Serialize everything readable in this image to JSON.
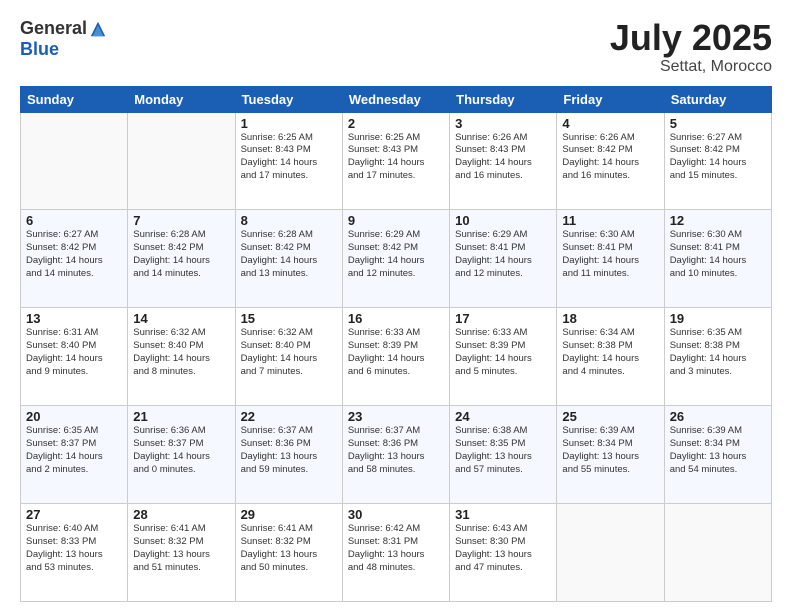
{
  "header": {
    "logo_general": "General",
    "logo_blue": "Blue",
    "month_title": "July 2025",
    "location": "Settat, Morocco"
  },
  "weekdays": [
    "Sunday",
    "Monday",
    "Tuesday",
    "Wednesday",
    "Thursday",
    "Friday",
    "Saturday"
  ],
  "weeks": [
    [
      {
        "day": "",
        "info": ""
      },
      {
        "day": "",
        "info": ""
      },
      {
        "day": "1",
        "info": "Sunrise: 6:25 AM\nSunset: 8:43 PM\nDaylight: 14 hours\nand 17 minutes."
      },
      {
        "day": "2",
        "info": "Sunrise: 6:25 AM\nSunset: 8:43 PM\nDaylight: 14 hours\nand 17 minutes."
      },
      {
        "day": "3",
        "info": "Sunrise: 6:26 AM\nSunset: 8:43 PM\nDaylight: 14 hours\nand 16 minutes."
      },
      {
        "day": "4",
        "info": "Sunrise: 6:26 AM\nSunset: 8:42 PM\nDaylight: 14 hours\nand 16 minutes."
      },
      {
        "day": "5",
        "info": "Sunrise: 6:27 AM\nSunset: 8:42 PM\nDaylight: 14 hours\nand 15 minutes."
      }
    ],
    [
      {
        "day": "6",
        "info": "Sunrise: 6:27 AM\nSunset: 8:42 PM\nDaylight: 14 hours\nand 14 minutes."
      },
      {
        "day": "7",
        "info": "Sunrise: 6:28 AM\nSunset: 8:42 PM\nDaylight: 14 hours\nand 14 minutes."
      },
      {
        "day": "8",
        "info": "Sunrise: 6:28 AM\nSunset: 8:42 PM\nDaylight: 14 hours\nand 13 minutes."
      },
      {
        "day": "9",
        "info": "Sunrise: 6:29 AM\nSunset: 8:42 PM\nDaylight: 14 hours\nand 12 minutes."
      },
      {
        "day": "10",
        "info": "Sunrise: 6:29 AM\nSunset: 8:41 PM\nDaylight: 14 hours\nand 12 minutes."
      },
      {
        "day": "11",
        "info": "Sunrise: 6:30 AM\nSunset: 8:41 PM\nDaylight: 14 hours\nand 11 minutes."
      },
      {
        "day": "12",
        "info": "Sunrise: 6:30 AM\nSunset: 8:41 PM\nDaylight: 14 hours\nand 10 minutes."
      }
    ],
    [
      {
        "day": "13",
        "info": "Sunrise: 6:31 AM\nSunset: 8:40 PM\nDaylight: 14 hours\nand 9 minutes."
      },
      {
        "day": "14",
        "info": "Sunrise: 6:32 AM\nSunset: 8:40 PM\nDaylight: 14 hours\nand 8 minutes."
      },
      {
        "day": "15",
        "info": "Sunrise: 6:32 AM\nSunset: 8:40 PM\nDaylight: 14 hours\nand 7 minutes."
      },
      {
        "day": "16",
        "info": "Sunrise: 6:33 AM\nSunset: 8:39 PM\nDaylight: 14 hours\nand 6 minutes."
      },
      {
        "day": "17",
        "info": "Sunrise: 6:33 AM\nSunset: 8:39 PM\nDaylight: 14 hours\nand 5 minutes."
      },
      {
        "day": "18",
        "info": "Sunrise: 6:34 AM\nSunset: 8:38 PM\nDaylight: 14 hours\nand 4 minutes."
      },
      {
        "day": "19",
        "info": "Sunrise: 6:35 AM\nSunset: 8:38 PM\nDaylight: 14 hours\nand 3 minutes."
      }
    ],
    [
      {
        "day": "20",
        "info": "Sunrise: 6:35 AM\nSunset: 8:37 PM\nDaylight: 14 hours\nand 2 minutes."
      },
      {
        "day": "21",
        "info": "Sunrise: 6:36 AM\nSunset: 8:37 PM\nDaylight: 14 hours\nand 0 minutes."
      },
      {
        "day": "22",
        "info": "Sunrise: 6:37 AM\nSunset: 8:36 PM\nDaylight: 13 hours\nand 59 minutes."
      },
      {
        "day": "23",
        "info": "Sunrise: 6:37 AM\nSunset: 8:36 PM\nDaylight: 13 hours\nand 58 minutes."
      },
      {
        "day": "24",
        "info": "Sunrise: 6:38 AM\nSunset: 8:35 PM\nDaylight: 13 hours\nand 57 minutes."
      },
      {
        "day": "25",
        "info": "Sunrise: 6:39 AM\nSunset: 8:34 PM\nDaylight: 13 hours\nand 55 minutes."
      },
      {
        "day": "26",
        "info": "Sunrise: 6:39 AM\nSunset: 8:34 PM\nDaylight: 13 hours\nand 54 minutes."
      }
    ],
    [
      {
        "day": "27",
        "info": "Sunrise: 6:40 AM\nSunset: 8:33 PM\nDaylight: 13 hours\nand 53 minutes."
      },
      {
        "day": "28",
        "info": "Sunrise: 6:41 AM\nSunset: 8:32 PM\nDaylight: 13 hours\nand 51 minutes."
      },
      {
        "day": "29",
        "info": "Sunrise: 6:41 AM\nSunset: 8:32 PM\nDaylight: 13 hours\nand 50 minutes."
      },
      {
        "day": "30",
        "info": "Sunrise: 6:42 AM\nSunset: 8:31 PM\nDaylight: 13 hours\nand 48 minutes."
      },
      {
        "day": "31",
        "info": "Sunrise: 6:43 AM\nSunset: 8:30 PM\nDaylight: 13 hours\nand 47 minutes."
      },
      {
        "day": "",
        "info": ""
      },
      {
        "day": "",
        "info": ""
      }
    ]
  ]
}
